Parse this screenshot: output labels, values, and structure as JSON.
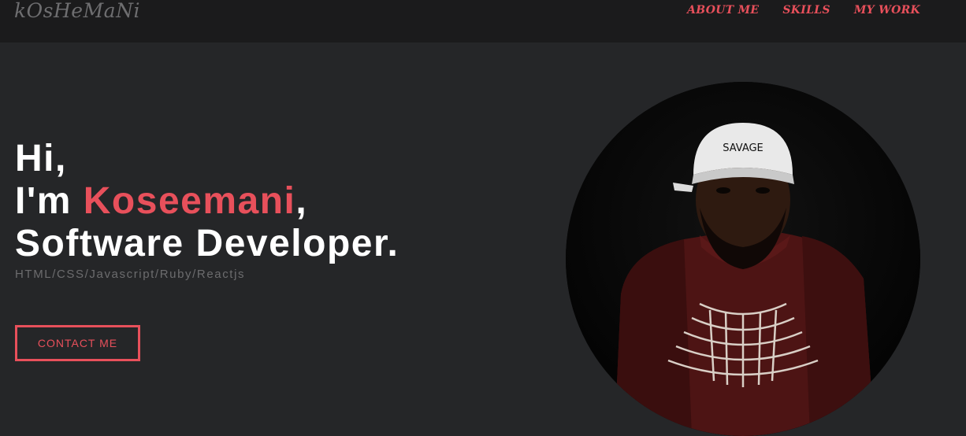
{
  "nav": {
    "logo": "kOsHeMaNi",
    "links": [
      "ABOUT ME",
      "SKILLS",
      "MY WORK"
    ]
  },
  "hero": {
    "line1": "Hi,",
    "line2_prefix": "I'm ",
    "name": "Koseemani",
    "line2_suffix": ",",
    "line3": "Software Developer.",
    "stack": "HTML/CSS/Javascript/Ruby/Reactjs",
    "cta": "CONTACT ME"
  },
  "photo": {
    "cap_text": "SAVAGE"
  },
  "colors": {
    "accent": "#e8505b",
    "background": "#252628",
    "navbar": "#1b1b1c"
  }
}
